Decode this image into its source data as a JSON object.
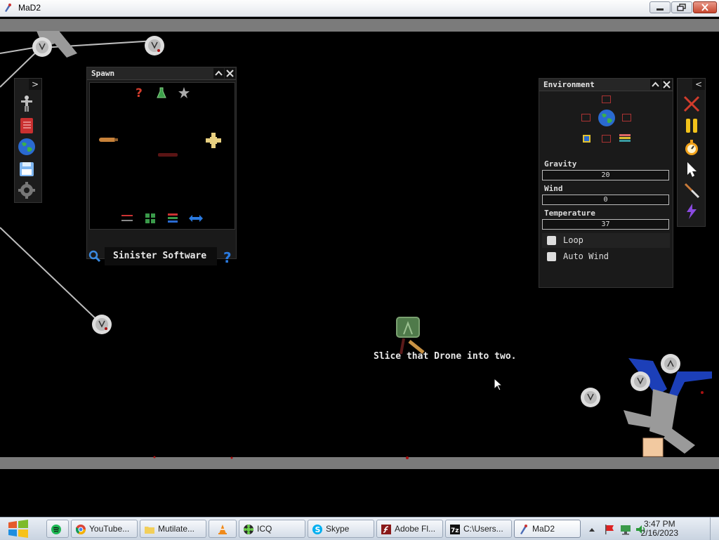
{
  "window": {
    "title": "MaD2",
    "buttons": [
      "minimize",
      "maximize",
      "close"
    ]
  },
  "spawn_panel": {
    "title": "Spawn",
    "footer_text": "Sinister Software",
    "top_icons": [
      "question-icon",
      "flask-icon",
      "star-icon"
    ],
    "items": [
      "bat-item",
      "drone-item",
      "bullet-item"
    ],
    "bottom_icons": [
      "sliders-icon",
      "grid-icon",
      "layers-icon",
      "swap-icon"
    ]
  },
  "environment_panel": {
    "title": "Environment",
    "gravity_label": "Gravity",
    "gravity_value": "20",
    "wind_label": "Wind",
    "wind_value": "0",
    "temperature_label": "Temperature",
    "temperature_value": "37",
    "loop_label": "Loop",
    "auto_wind_label": "Auto Wind"
  },
  "left_toolbar": {
    "collapse_glyph": ">",
    "tools": [
      "ragdoll-icon",
      "book-icon",
      "globe-icon",
      "save-icon",
      "settings-icon"
    ]
  },
  "right_toolbar": {
    "collapse_glyph": "<",
    "tools": [
      "clear-icon",
      "pause-icon",
      "stopwatch-icon",
      "cursor-icon",
      "knife-icon",
      "lightning-icon"
    ]
  },
  "game": {
    "message": "Slice that Drone into two."
  },
  "taskbar": {
    "items": [
      {
        "label": "",
        "icon": "spotify-icon"
      },
      {
        "label": "YouTube...",
        "icon": "chrome-icon"
      },
      {
        "label": "Mutilate...",
        "icon": "folder-icon"
      },
      {
        "label": "",
        "icon": "vlc-icon"
      },
      {
        "label": "ICQ",
        "icon": "icq-icon"
      },
      {
        "label": "Skype",
        "icon": "skype-icon"
      },
      {
        "label": "Adobe Fl...",
        "icon": "flash-icon"
      },
      {
        "label": "C:\\Users...",
        "icon": "7zip-icon"
      },
      {
        "label": "MaD2",
        "icon": "mad2-icon"
      }
    ],
    "time": "3:47 PM",
    "date": "2/16/2023"
  },
  "colors": {
    "accent_red": "#d23c2c",
    "globe_blue": "#2a6ad0",
    "pause_yellow": "#f2c21a",
    "lightning_purple": "#8a4ae0"
  }
}
